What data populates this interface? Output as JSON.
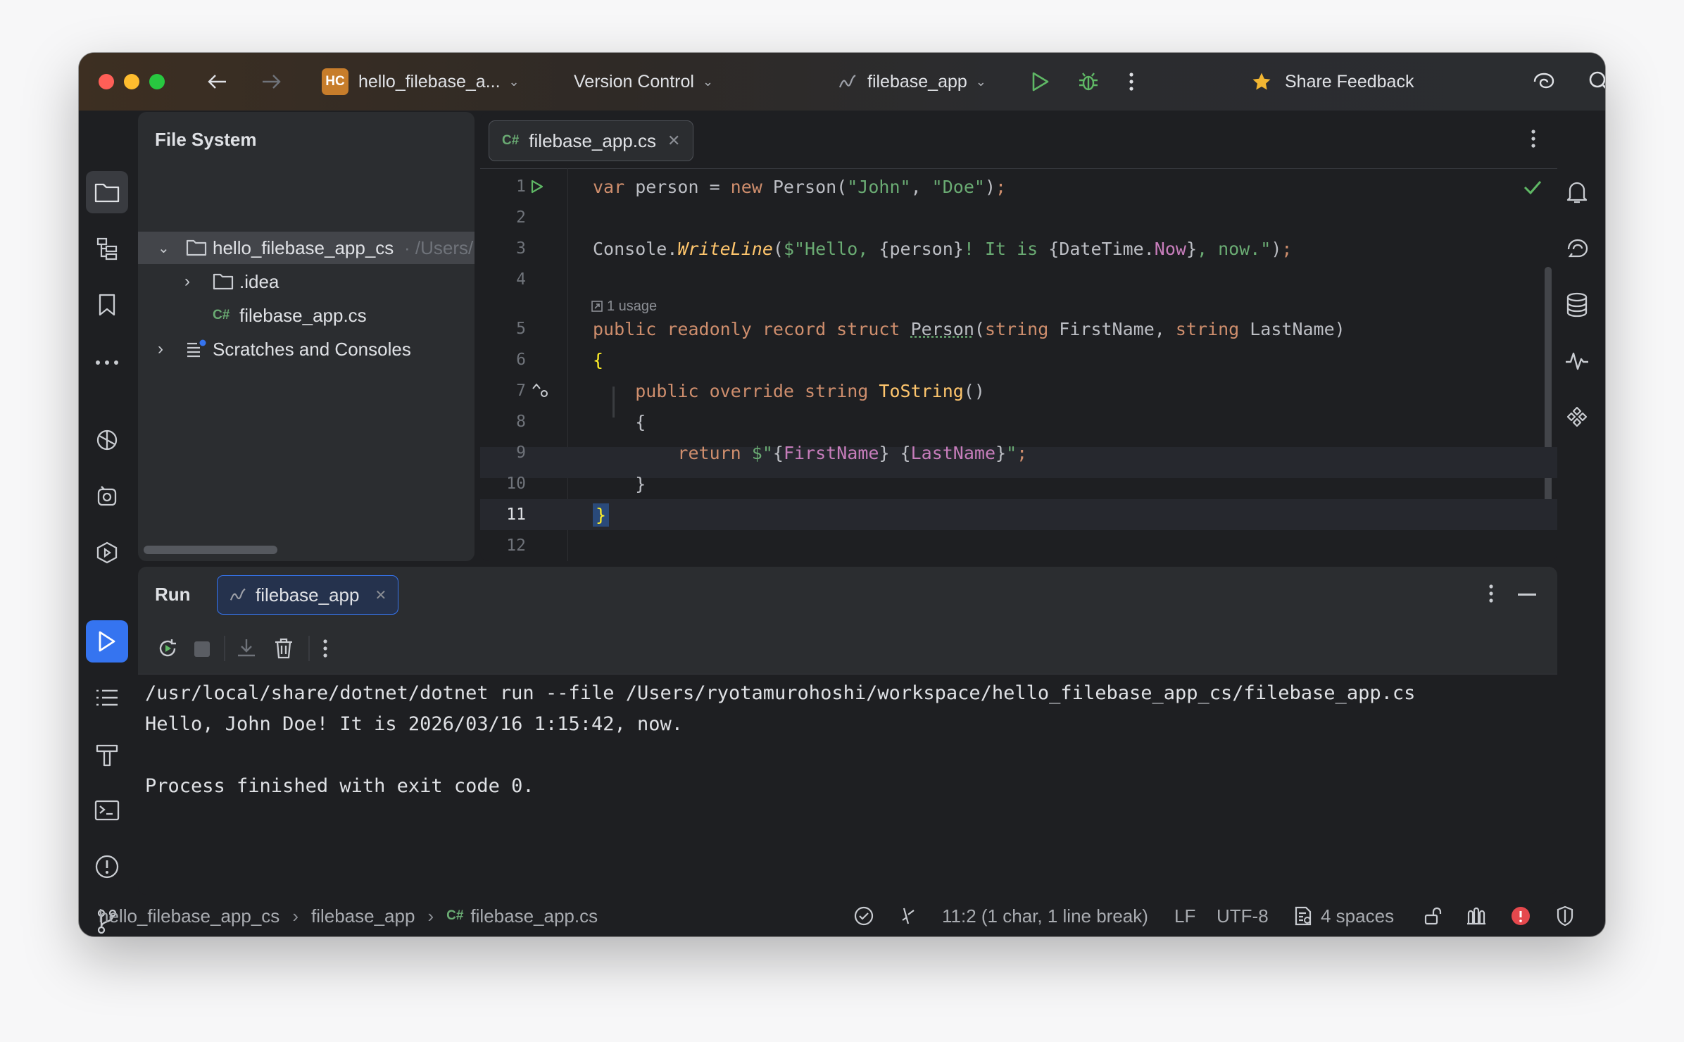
{
  "titlebar": {
    "project_badge": "HC",
    "project_name": "hello_filebase_a...",
    "vcs_label": "Version Control",
    "run_config": "filebase_app",
    "share_feedback": "Share Feedback"
  },
  "file_panel": {
    "title": "File System",
    "tree": [
      {
        "label": "hello_filebase_app_cs",
        "hint": "· /Users/"
      },
      {
        "label": ".idea"
      },
      {
        "label": "filebase_app.cs",
        "lang_badge": "C#"
      },
      {
        "label": "Scratches and Consoles"
      }
    ]
  },
  "editor": {
    "tab_badge": "C#",
    "tab_label": "filebase_app.cs",
    "usage_hint": "1 usage",
    "lines": [
      "1",
      "2",
      "3",
      "4",
      "5",
      "6",
      "7",
      "8",
      "9",
      "10",
      "11",
      "12"
    ]
  },
  "run_panel": {
    "title": "Run",
    "tab_label": "filebase_app",
    "output": [
      "/usr/local/share/dotnet/dotnet run --file /Users/ryotamurohoshi/workspace/hello_filebase_app_cs/filebase_app.cs",
      "Hello, John Doe! It is 2026/03/16 1:15:42, now.",
      "",
      "Process finished with exit code 0."
    ]
  },
  "statusbar": {
    "crumb_project": "hello_filebase_app_cs",
    "crumb_config": "filebase_app",
    "crumb_badge": "C#",
    "crumb_file": "filebase_app.cs",
    "position": "11:2 (1 char, 1 line break)",
    "line_sep": "LF",
    "encoding": "UTF-8",
    "indent": "4 spaces"
  },
  "colors": {
    "accent": "#3574f0",
    "run_green": "#5fb865",
    "keyword": "#cf8e6d",
    "string": "#6aab73",
    "method": "#ffc66d",
    "property": "#c77dbb",
    "error_red": "#e5484d"
  }
}
